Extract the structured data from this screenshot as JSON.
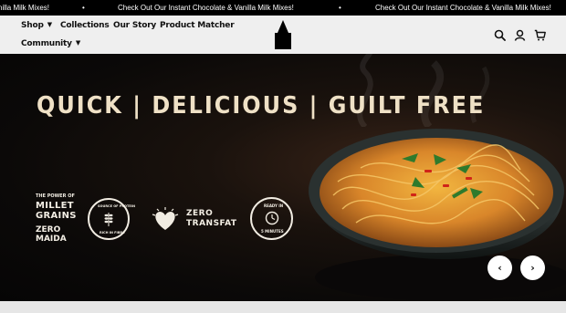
{
  "announcement": {
    "message": "Check Out Our Instant Chocolate & Vanilla Milk Mixes!",
    "partial_left": "nilla Milk Mixes!",
    "separator": "•"
  },
  "nav": {
    "shop": "Shop",
    "collections": "Collections",
    "our_story": "Our Story",
    "product_matcher": "Product Matcher",
    "community": "Community"
  },
  "icons": {
    "search": "search-icon",
    "account": "account-icon",
    "cart": "cart-icon",
    "logo": "brand-logo"
  },
  "hero": {
    "headline": "QUICK | DELICIOUS | GUILT FREE",
    "badges": {
      "millet_power_line": "THE POWER OF",
      "millet_line1": "MILLET",
      "millet_line2": "GRAINS",
      "zero_maida_line1": "ZERO",
      "zero_maida_line2": "MAIDA",
      "protein_top": "SOURCE OF PROTEIN",
      "protein_bottom": "RICH IN FIBRE",
      "zero_transfat_line1": "ZERO",
      "zero_transfat_line2": "TRANSFAT",
      "ready_top": "READY IN",
      "ready_bottom": "5 MINUTES"
    }
  },
  "carousel": {
    "prev": "‹",
    "next": "›"
  },
  "colors": {
    "announcement_bg": "#000000",
    "header_bg": "#efefef",
    "headline": "#efe1c6"
  }
}
